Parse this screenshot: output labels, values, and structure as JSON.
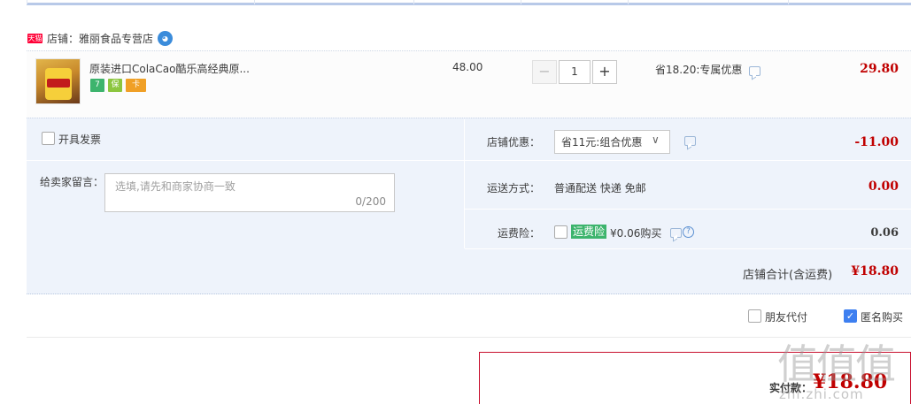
{
  "shop": {
    "badge": "天猫",
    "name": "店铺：雅丽食品专营店"
  },
  "item": {
    "title": "原装进口ColaCao酷乐高经典原...",
    "services": [
      "7",
      "保",
      "卡"
    ],
    "unit_price": "48.00",
    "qty_minus": "−",
    "qty": "1",
    "qty_plus": "+",
    "promo": "省18.20:专属优惠",
    "total": "29.80"
  },
  "options": {
    "invoice_label": "开具发票",
    "message_label": "给卖家留言：",
    "message_placeholder": "选填,请先和商家协商一致",
    "message_count": "0/200",
    "shop_discount_label": "店铺优惠：",
    "shop_discount_value": "省11元:组合优惠",
    "shop_discount_chevron": "∨",
    "shop_discount_amount": "-11.00",
    "shipping_label": "运送方式：",
    "shipping_value": "普通配送 快递 免邮",
    "shipping_amount": "0.00",
    "insurance_label": "运费险：",
    "insurance_tag": "运费险",
    "insurance_price": "¥0.06购买",
    "insurance_amount": "0.06",
    "help_glyph": "?",
    "subtotal_label": "店铺合计(含运费)",
    "subtotal_amount": "¥18.80"
  },
  "pay_options": {
    "friend_label": "朋友代付",
    "anon_label": "匿名购买",
    "anon_checked": true
  },
  "payment": {
    "label": "实付款：",
    "amount": "¥18.80"
  },
  "watermark": {
    "glyphs": "值值值",
    "url": "zhi.zhi.com"
  },
  "colors": {
    "price_red": "#c00000",
    "accent_blue": "#3d7ff0",
    "option_bg": "#eef3fb",
    "tmall_red": "#ff0036"
  }
}
